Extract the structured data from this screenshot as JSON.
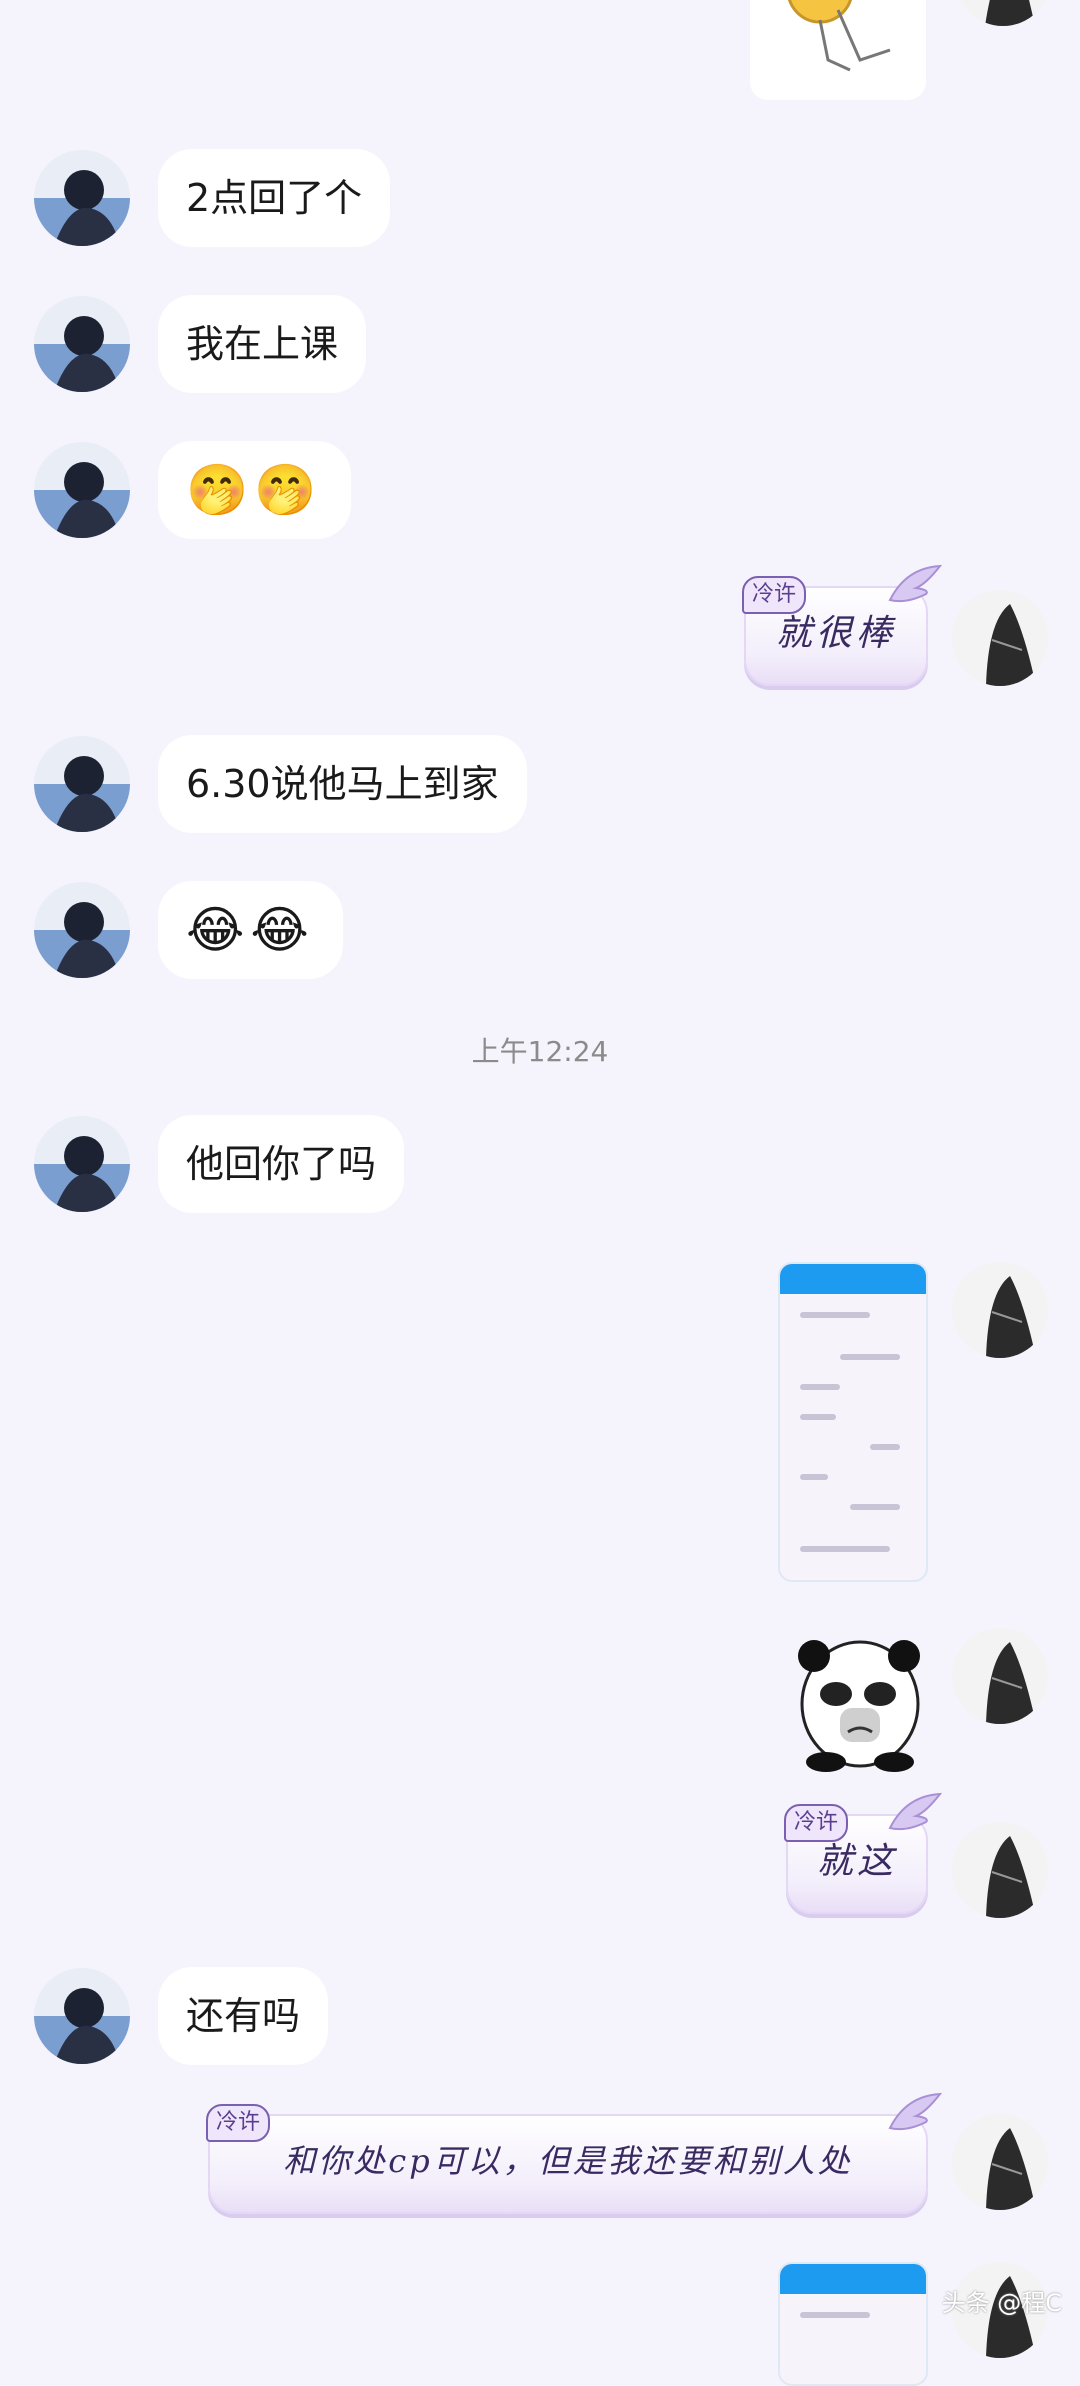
{
  "conversation": {
    "messages": [
      {
        "text": "2点回了个"
      },
      {
        "text": "我在上课"
      },
      {
        "text": "🤭🤭"
      },
      {
        "text": "6.30说他马上到家"
      },
      {
        "text": "😂😂"
      },
      {
        "text": "他回你了吗"
      },
      {
        "text": "还有吗"
      }
    ],
    "timestamp": "上午12:24",
    "cards": [
      {
        "tag": "冷许",
        "text": "就很棒"
      },
      {
        "tag": "冷许",
        "text": "就这"
      },
      {
        "tag": "冷许",
        "text": "和你处cp可以，但是我还要和别人处"
      }
    ]
  },
  "watermark": "头条 @程C"
}
